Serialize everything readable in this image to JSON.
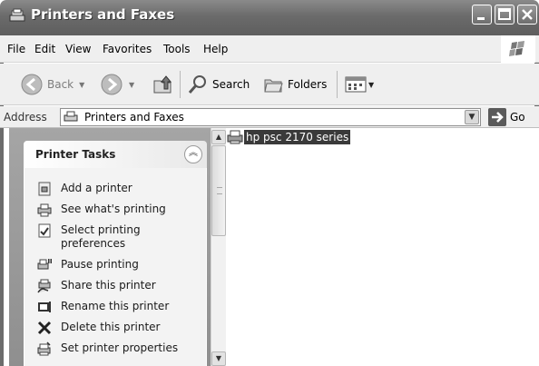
{
  "window": {
    "title": "Printers and Faxes"
  },
  "menu": {
    "items": [
      "File",
      "Edit",
      "View",
      "Favorites",
      "Tools",
      "Help"
    ]
  },
  "toolbar": {
    "back_label": "Back",
    "search_label": "Search",
    "folders_label": "Folders"
  },
  "address": {
    "label": "Address",
    "value": "Printers and Faxes",
    "go_label": "Go"
  },
  "tasks": {
    "title": "Printer Tasks",
    "items": [
      {
        "label": "Add a printer",
        "icon": "add-printer-icon"
      },
      {
        "label": "See what's printing",
        "icon": "print-queue-icon"
      },
      {
        "label": "Select printing preferences",
        "icon": "preferences-icon"
      },
      {
        "label": "Pause printing",
        "icon": "pause-printer-icon"
      },
      {
        "label": "Share this printer",
        "icon": "share-printer-icon"
      },
      {
        "label": "Rename this printer",
        "icon": "rename-icon"
      },
      {
        "label": "Delete this printer",
        "icon": "delete-x-icon"
      },
      {
        "label": "Set printer properties",
        "icon": "properties-icon"
      }
    ]
  },
  "content": {
    "printers": [
      {
        "name": "hp psc 2170 series",
        "selected": true
      }
    ]
  }
}
